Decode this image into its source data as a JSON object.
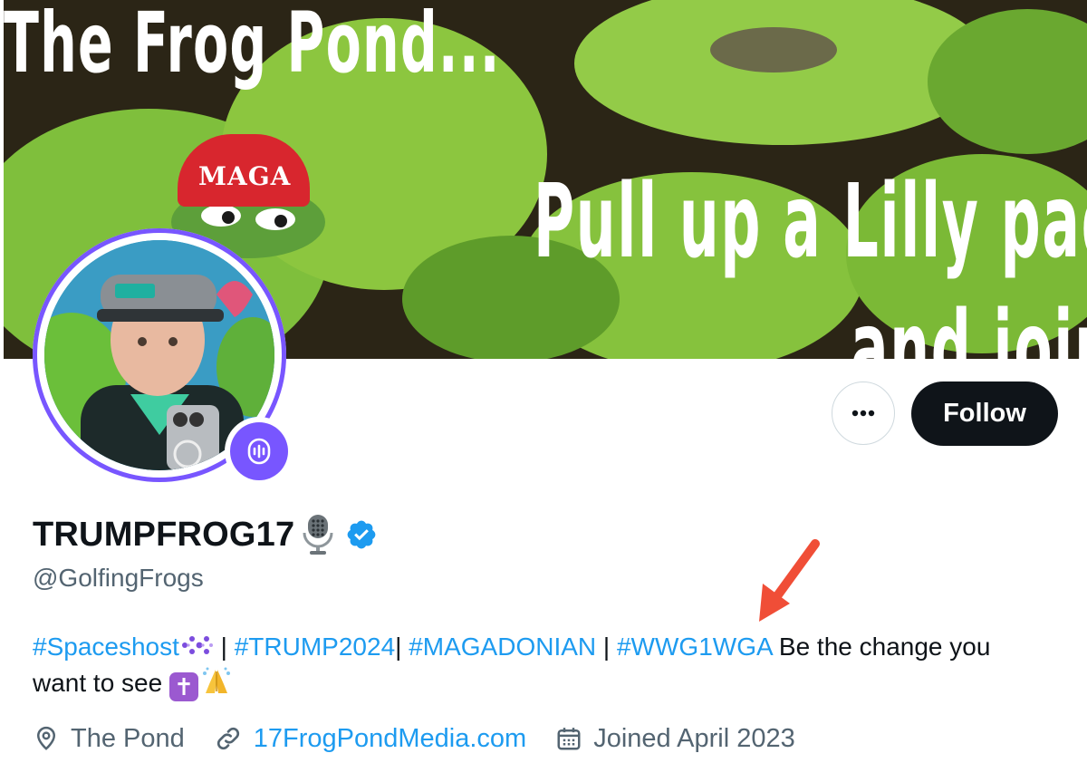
{
  "banner": {
    "title": "The Frog Pond...",
    "subtitle": "Pull up a Lilly pad",
    "subtitle_cont": "and join",
    "hat_text": "MAGA"
  },
  "profile": {
    "display_name": "TRUMPFROG17",
    "handle": "@GolfingFrogs",
    "verified": true,
    "name_emoji": "microphone-icon"
  },
  "actions": {
    "more_label": "More",
    "follow_label": "Follow"
  },
  "bio": {
    "tag1": "#Spaceshost",
    "sep1": " | ",
    "tag2": "#TRUMP2024",
    "sep2": "| ",
    "tag3": "#MAGADONIAN",
    "sep3": " | ",
    "tag4": "#WWG1WGA",
    "text": " Be the change you want to see "
  },
  "meta": {
    "location": "The Pond",
    "website": "17FrogPondMedia.com",
    "joined": "Joined April 2023"
  },
  "colors": {
    "accent": "#1d9bf0",
    "spaces_purple": "#7856ff",
    "follow_bg": "#0f1419",
    "secondary_text": "#536471",
    "annotation_arrow": "#f04e37"
  }
}
